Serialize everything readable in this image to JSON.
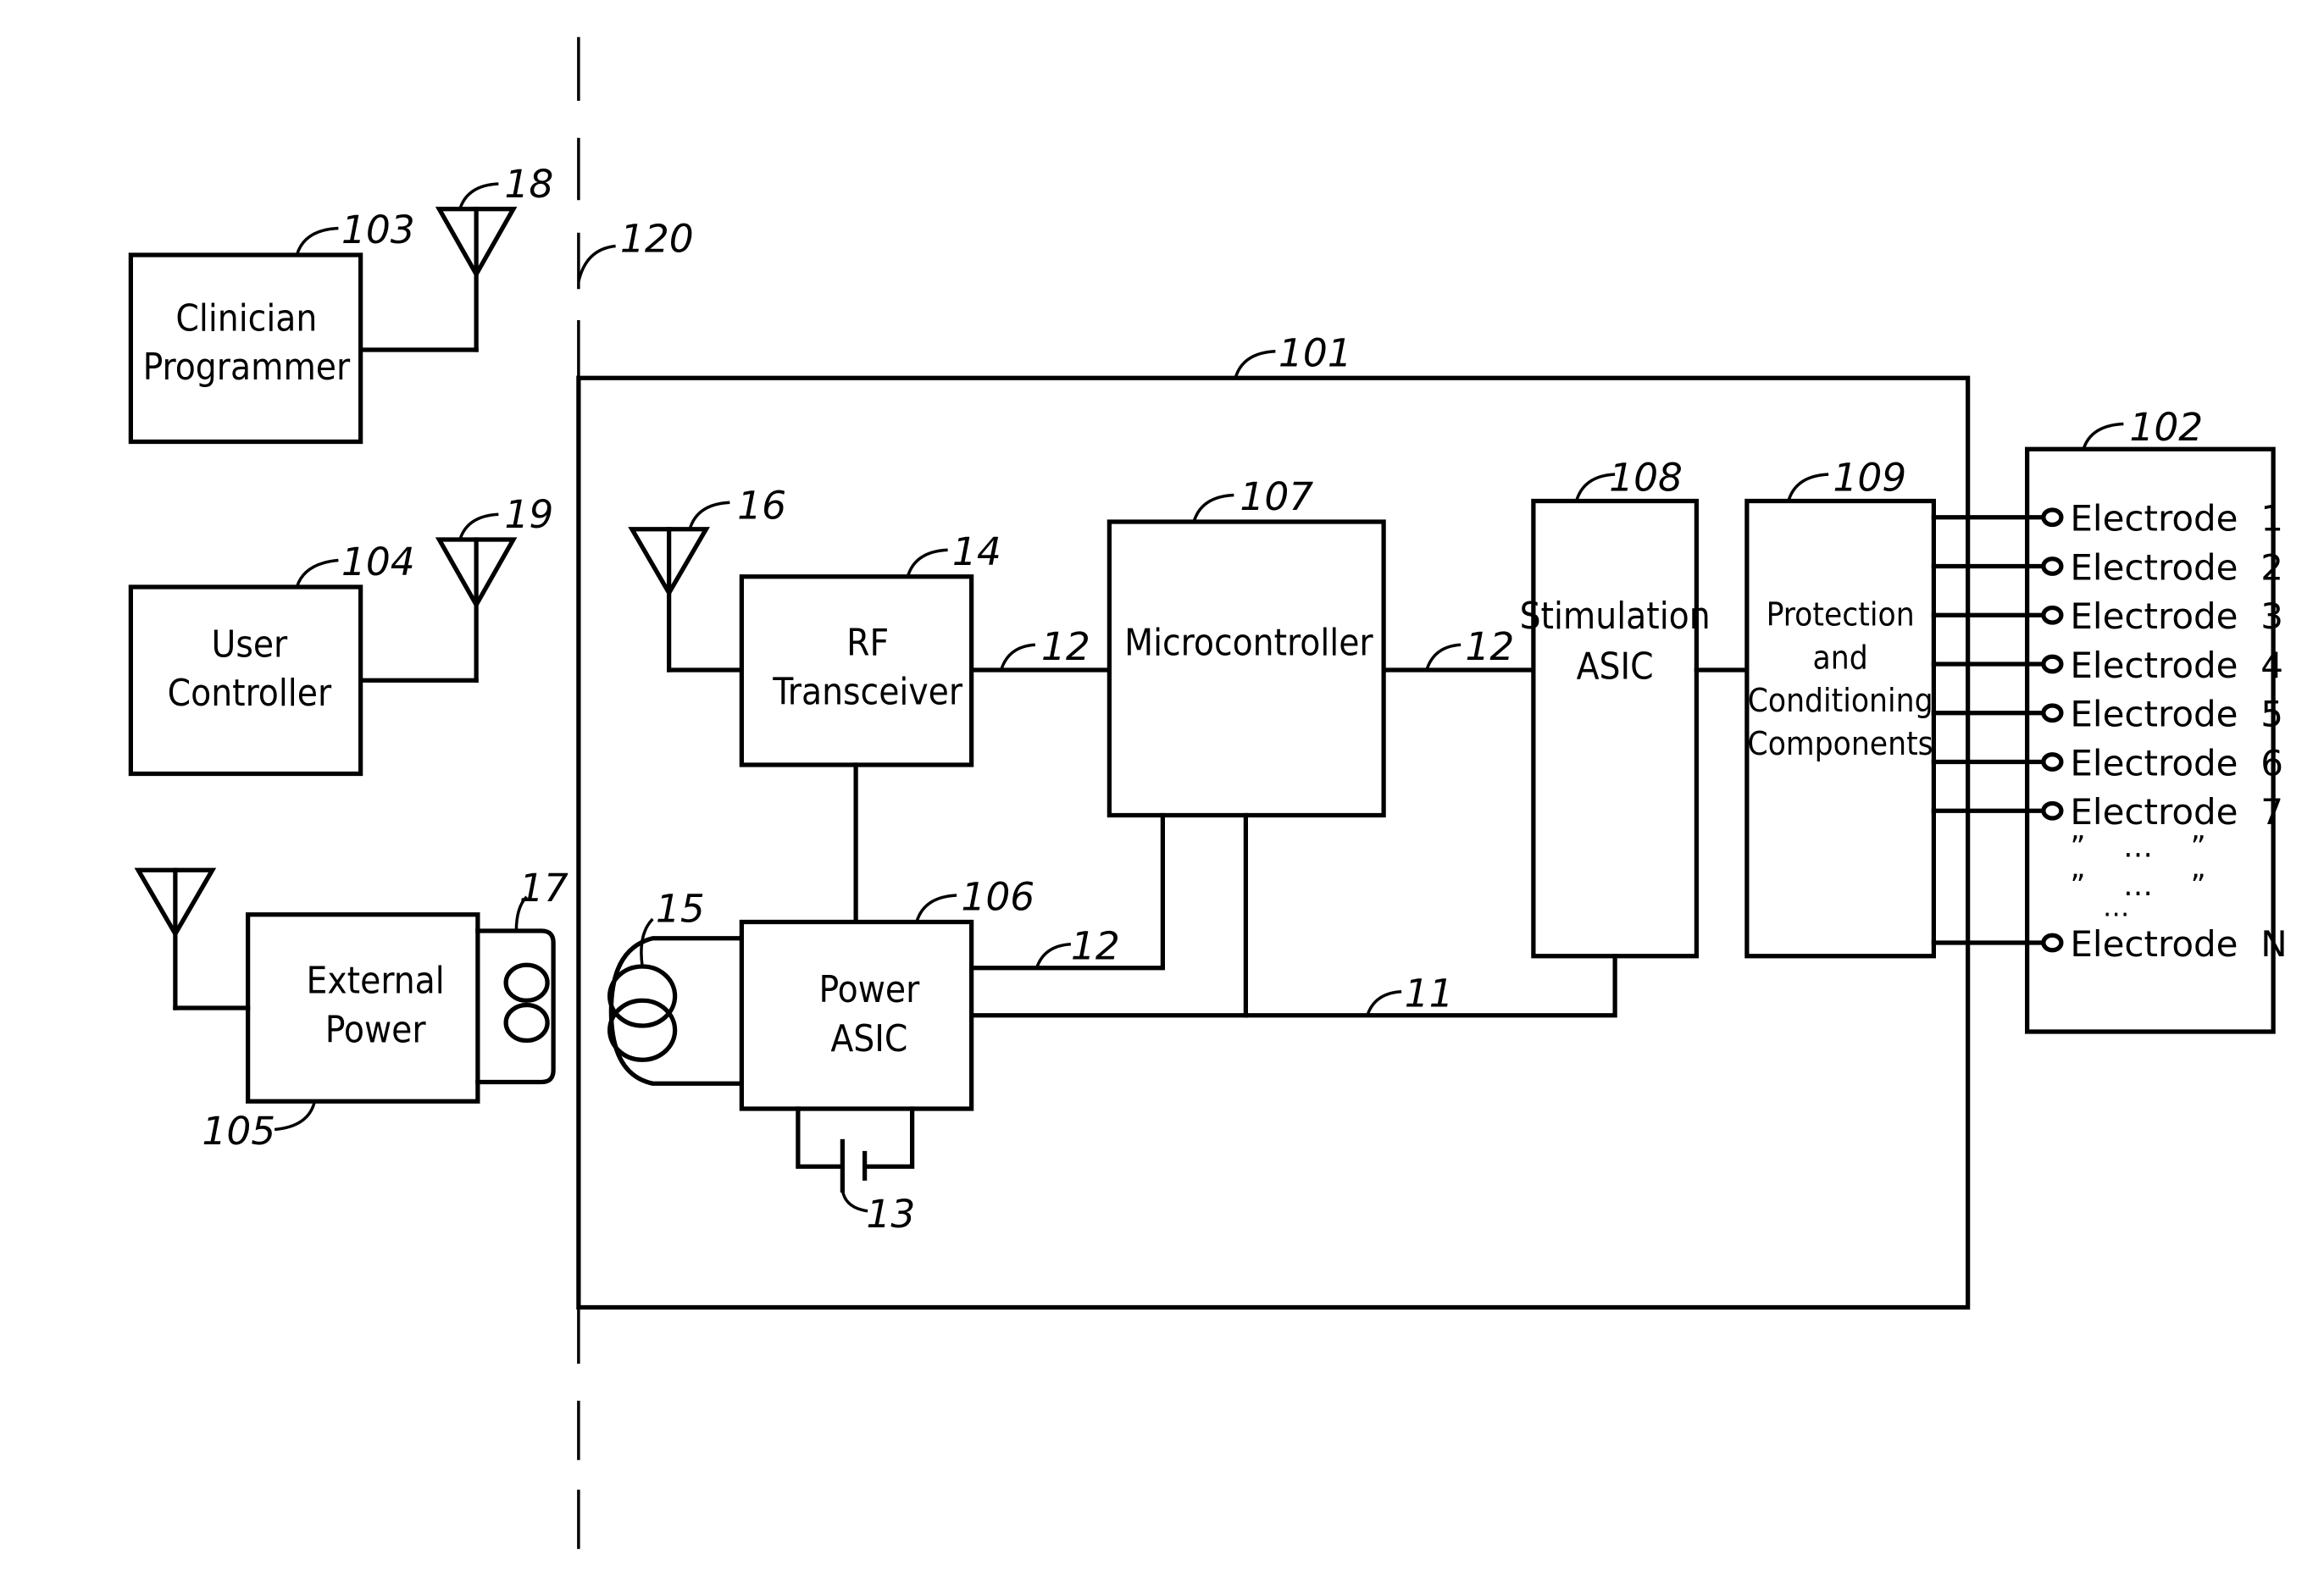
{
  "figure": {
    "boundary_ref": "120",
    "external_devices": [
      {
        "id": "clinician_programmer",
        "ref": "103",
        "lines": [
          "Clinician",
          "Programmer"
        ],
        "antenna_ref": "18"
      },
      {
        "id": "user_controller",
        "ref": "104",
        "lines": [
          "User",
          "Controller"
        ],
        "antenna_ref": "19"
      },
      {
        "id": "external_power",
        "ref": "105",
        "lines": [
          "External",
          "Power"
        ],
        "coil_ref": "17"
      }
    ],
    "implant": {
      "ref": "101",
      "antenna_ref": "16",
      "coil_ref": "15",
      "battery_ref": "13",
      "blocks": {
        "rf_transceiver": {
          "ref": "14",
          "lines": [
            "RF",
            "Transceiver"
          ]
        },
        "microcontroller": {
          "ref": "107",
          "lines": [
            "Microcontroller"
          ]
        },
        "stimulation_asic": {
          "ref": "108",
          "lines": [
            "Stimulation",
            "ASIC"
          ]
        },
        "protection": {
          "ref": "109",
          "lines": [
            "Protection",
            "and",
            "Conditioning",
            "Components"
          ]
        },
        "power_asic": {
          "ref": "106",
          "lines": [
            "Power",
            "ASIC"
          ]
        }
      },
      "bus_refs": {
        "rf_to_mcu": "12",
        "mcu_to_stim": "12",
        "power_to_mcu": "12",
        "power_bus": "11"
      }
    },
    "electrode_array": {
      "ref": "102",
      "electrodes": [
        "Electrode  1",
        "Electrode  2",
        "Electrode  3",
        "Electrode  4",
        "Electrode  5",
        "Electrode  6",
        "Electrode  7"
      ],
      "ellipsis_rows": [
        "”    …    ”",
        "”    …    ”"
      ],
      "ellipsis_dots": "…",
      "last_electrode": "Electrode  N"
    }
  }
}
